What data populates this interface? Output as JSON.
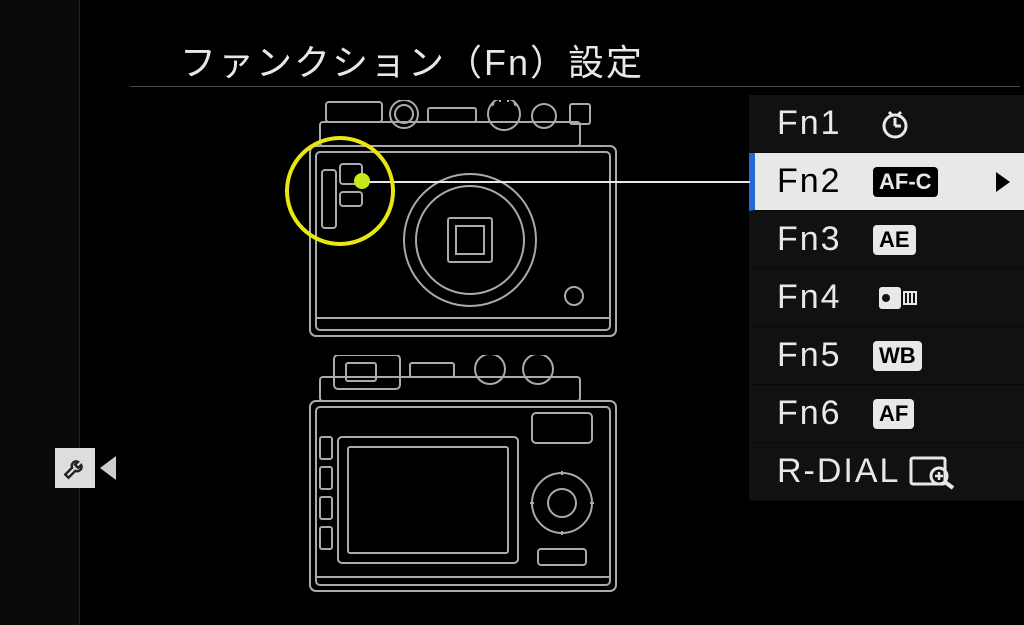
{
  "title": "ファンクション（Fn）設定",
  "selected_index": 1,
  "fn_items": [
    {
      "label": "Fn1",
      "icon": "self-timer",
      "badge": null
    },
    {
      "label": "Fn2",
      "icon": null,
      "badge": "AF-C"
    },
    {
      "label": "Fn3",
      "icon": null,
      "badge": "AE"
    },
    {
      "label": "Fn4",
      "icon": "film-simulation",
      "badge": null
    },
    {
      "label": "Fn5",
      "icon": null,
      "badge": "WB"
    },
    {
      "label": "Fn6",
      "icon": null,
      "badge": "AF"
    },
    {
      "label": "R-DIAL",
      "icon": "focus-zoom",
      "badge": null
    }
  ]
}
